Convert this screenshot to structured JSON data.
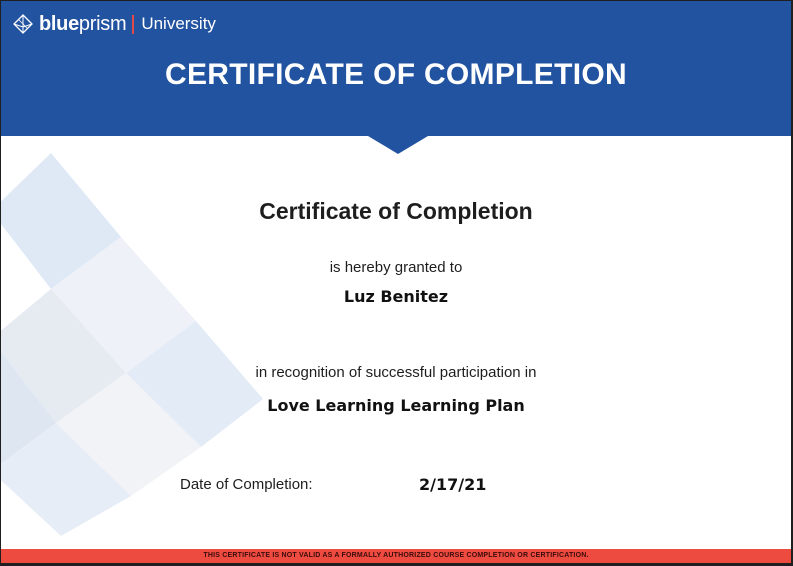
{
  "logo": {
    "brand_bold": "blue",
    "brand_light": "prism",
    "brand_suffix": "University"
  },
  "banner": {
    "title": "CERTIFICATE OF COMPLETION"
  },
  "certificate": {
    "heading": "Certificate of Completion",
    "granted_text": "is hereby granted to",
    "recipient": "Luz Benitez",
    "recognition_text": "in recognition of successful participation in",
    "course": "Love Learning Learning Plan",
    "date_label": "Date of Completion:",
    "date_value": "2/17/21"
  },
  "footer": {
    "disclaimer": "THIS CERTIFICATE IS NOT VALID AS A FORMALLY AUTHORIZED COURSE COMPLETION OR CERTIFICATION."
  },
  "colors": {
    "header_blue": "#2253a0",
    "footer_red": "#ee4b40",
    "separator_red": "#e24a4a"
  },
  "icons": {
    "logo": "prism-logo-icon"
  }
}
